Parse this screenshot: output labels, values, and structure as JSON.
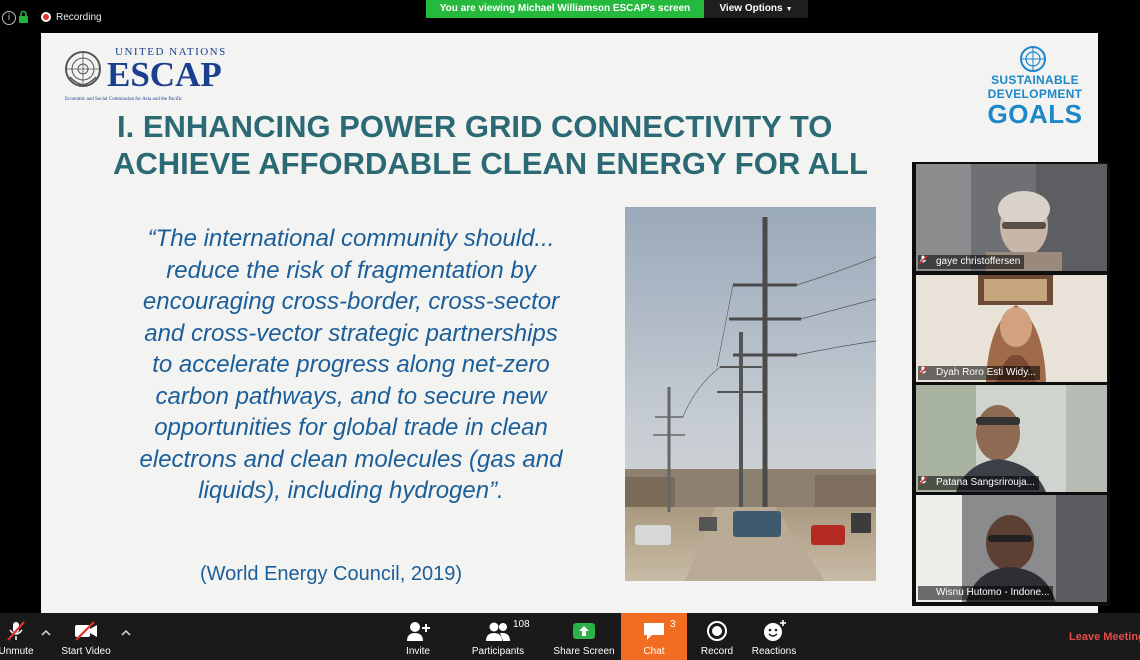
{
  "top_bar": {
    "recording_label": "Recording",
    "viewing_banner": "You are viewing Michael Williamson ESCAP's screen",
    "view_options_label": "View Options",
    "colors": {
      "banner": "#25b93e",
      "recording_dot": "#e0322c"
    }
  },
  "slide": {
    "logo": {
      "united_nations": "UNITED NATIONS",
      "name": "ESCAP",
      "subtitle": "Economic and Social Commission for Asia and the Pacific"
    },
    "sdg_logo": {
      "line1": "SUSTAINABLE",
      "line2": "DEVELOPMENT",
      "line3": "GOALS"
    },
    "title": {
      "line1": "I. ENHANCING POWER GRID CONNECTIVITY TO",
      "line2": "ACHIEVE AFFORDABLE CLEAN ENERGY FOR ALL"
    },
    "quote_lines": [
      "“The international community should...",
      "reduce the risk of fragmentation by",
      "encouraging cross-border, cross-sector",
      "and cross-vector strategic partnerships",
      "to accelerate progress along net-zero",
      "carbon pathways, and to secure new",
      "opportunities for global trade in clean",
      "electrons and clean molecules (gas and",
      "liquids), including hydrogen”."
    ],
    "citation": "(World Energy Council, 2019)",
    "colors": {
      "title": "#2b6a74",
      "quote": "#1b5e99",
      "sdg": "#1c87c9",
      "escap": "#1b3f8f"
    }
  },
  "participants_video": [
    {
      "name": "gaye christoffersen",
      "muted": true
    },
    {
      "name": "Dyah Roro Esti Widy...",
      "muted": true
    },
    {
      "name": "Patana Sangsrirouja...",
      "muted": true
    },
    {
      "name": "Wisnu Hutomo - Indone...",
      "muted": false
    }
  ],
  "toolbar": {
    "unmute_label": "Unmute",
    "start_video_label": "Start Video",
    "invite_label": "Invite",
    "participants_label": "Participants",
    "participants_count": "108",
    "share_screen_label": "Share Screen",
    "chat_label": "Chat",
    "chat_count": "3",
    "record_label": "Record",
    "reactions_label": "Reactions",
    "leave_label": "Leave Meeting",
    "colors": {
      "chat_active": "#f26d21",
      "share": "#2fb14a",
      "leave": "#e34c4c"
    }
  }
}
